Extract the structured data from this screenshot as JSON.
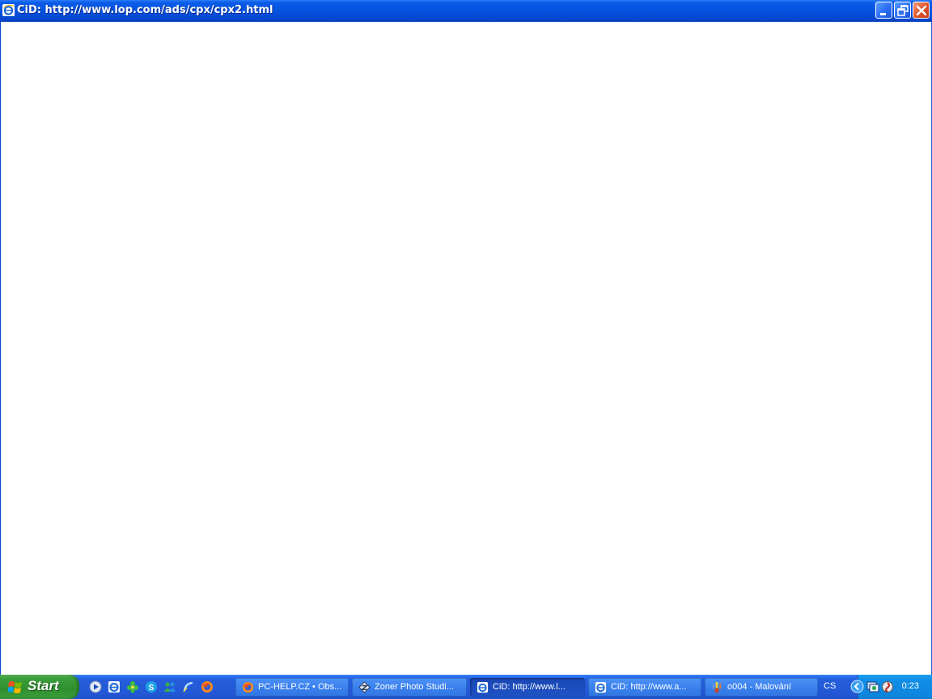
{
  "window": {
    "title": "CiD: http://www.lop.com/ads/cpx/cpx2.html",
    "icon": "ie-icon",
    "controls": [
      "minimize-icon",
      "restore-icon",
      "close-icon"
    ],
    "accent": "#0553e0"
  },
  "taskbar": {
    "start_label": "Start",
    "quick_launch": [
      "media-player-icon",
      "ie-icon",
      "green-app-icon",
      "skype-icon",
      "messenger-icon",
      "ie-icon",
      "firefox-icon"
    ],
    "tasks": [
      {
        "label": "PC-HELP.CZ • Obs...",
        "icon": "firefox-icon",
        "active": false
      },
      {
        "label": "Zoner Photo Studi...",
        "icon": "zoner-icon",
        "active": false
      },
      {
        "label": "CiD: http://www.l...",
        "icon": "ie-icon",
        "active": true
      },
      {
        "label": "CiD: http://www.a...",
        "icon": "ie-icon",
        "active": false
      },
      {
        "label": "o004 - Malování",
        "icon": "paint-icon",
        "active": false
      }
    ],
    "language": "CS",
    "clock": "0:23"
  }
}
